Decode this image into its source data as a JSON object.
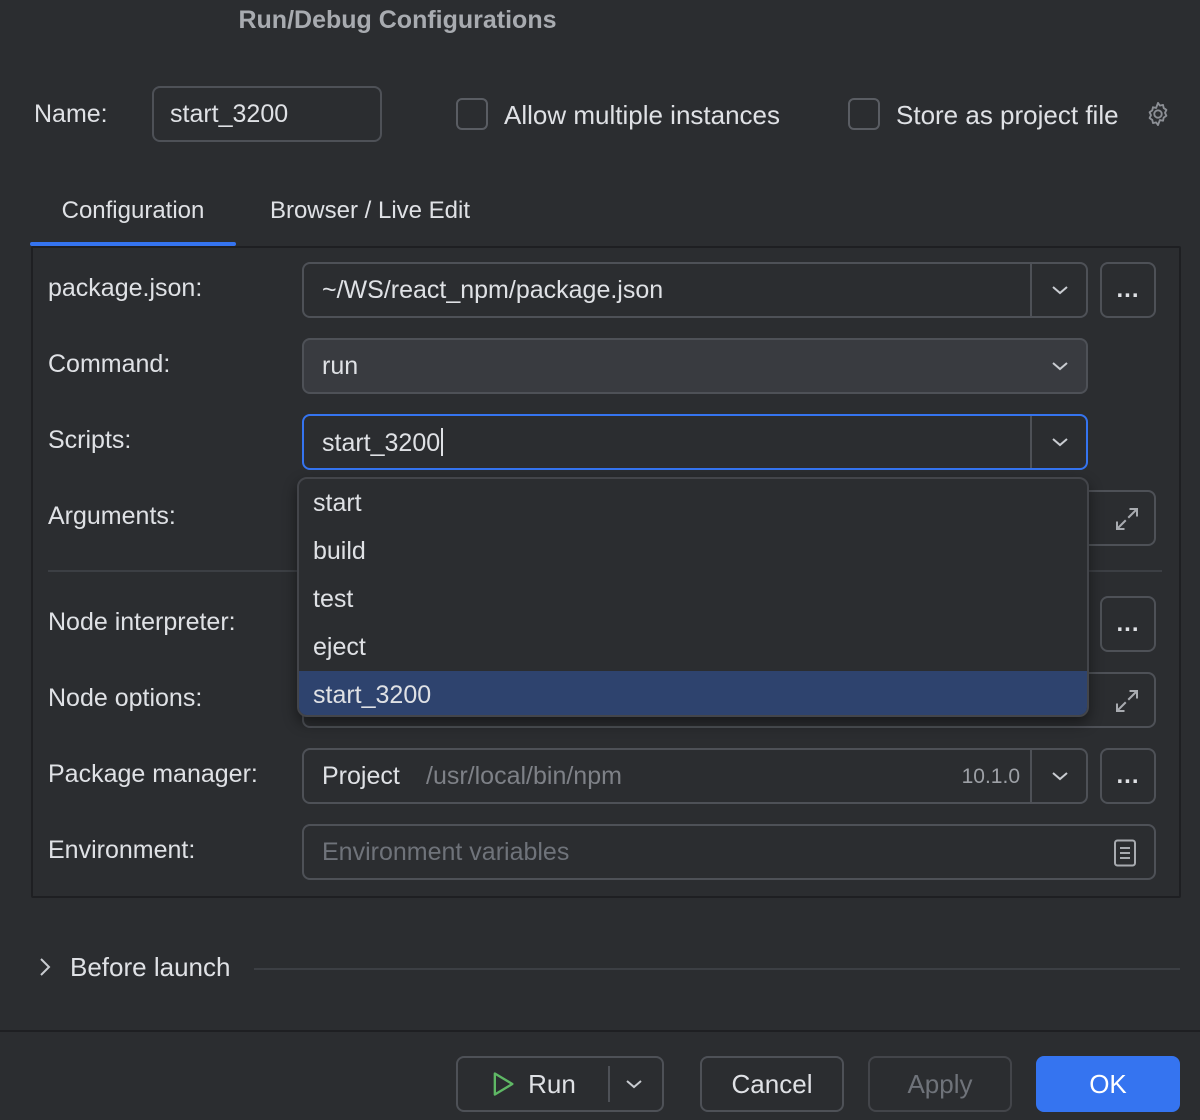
{
  "window": {
    "title": "Run/Debug Configurations"
  },
  "name_row": {
    "label": "Name:",
    "value": "start_3200",
    "allow_multiple_label": "Allow multiple instances",
    "allow_multiple_checked": false,
    "store_project_label": "Store as project file",
    "store_project_checked": false
  },
  "tabs": [
    {
      "label": "Configuration",
      "active": true
    },
    {
      "label": "Browser / Live Edit",
      "active": false
    }
  ],
  "form": {
    "package_json": {
      "label": "package.json:",
      "value": "~/WS/react_npm/package.json",
      "browse": "..."
    },
    "command": {
      "label": "Command:",
      "value": "run"
    },
    "scripts": {
      "label": "Scripts:",
      "value": "start_3200"
    },
    "arguments": {
      "label": "Arguments:"
    },
    "node_interpreter": {
      "label": "Node interpreter:",
      "browse": "..."
    },
    "node_options": {
      "label": "Node options:"
    },
    "package_manager": {
      "label": "Package manager:",
      "value": "Project",
      "path": "/usr/local/bin/npm",
      "version": "10.1.0",
      "browse": "..."
    },
    "environment": {
      "label": "Environment:",
      "placeholder": "Environment variables"
    }
  },
  "scripts_dropdown": {
    "options": [
      "start",
      "build",
      "test",
      "eject",
      "start_3200"
    ],
    "selected": "start_3200"
  },
  "before_launch": {
    "label": "Before launch"
  },
  "footer": {
    "run_label": "Run",
    "cancel_label": "Cancel",
    "apply_label": "Apply",
    "ok_label": "OK"
  },
  "colors": {
    "background": "#2b2d30",
    "accent": "#3574f0",
    "selection": "#2e436e",
    "run_icon": "#5fb865"
  }
}
